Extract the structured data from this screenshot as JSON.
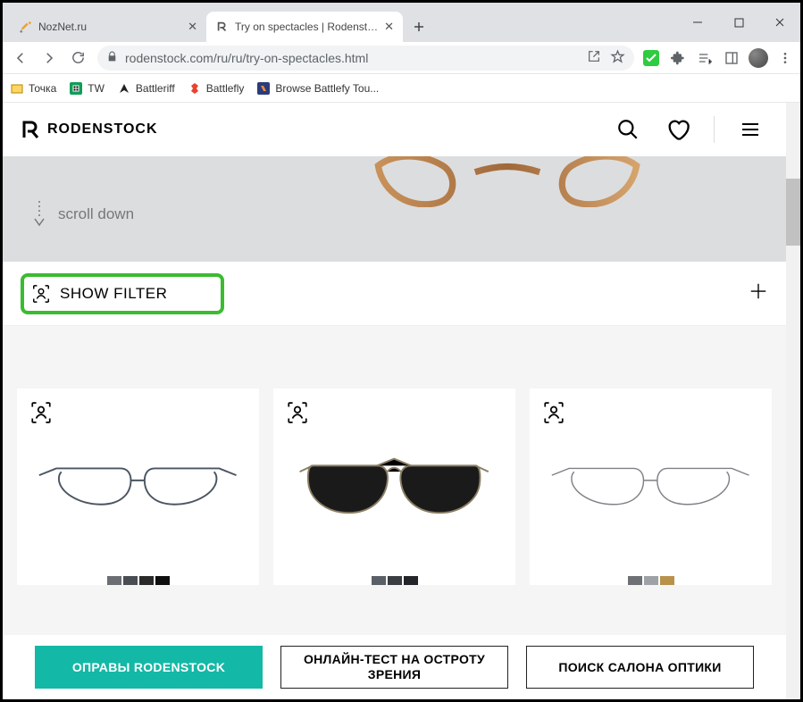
{
  "window": {
    "minimize": "—",
    "maximize": "▢",
    "close": "✕"
  },
  "tabs": [
    {
      "title": "NozNet.ru"
    },
    {
      "title": "Try on spectacles | Rodenstock"
    }
  ],
  "url": {
    "host": "rodenstock.com",
    "path": "/ru/ru/try-on-spectacles.html"
  },
  "bookmarks": [
    {
      "label": "Точка"
    },
    {
      "label": "TW"
    },
    {
      "label": "Battleriff"
    },
    {
      "label": "Battlefly"
    },
    {
      "label": "Browse Battlefy Tou..."
    }
  ],
  "brand": "RODENSTOCK",
  "banner": {
    "scroll": "scroll down"
  },
  "filter": {
    "label": "SHOW FILTER"
  },
  "cta": [
    "ОПРАВЫ RODENSTOCK",
    "ОНЛАЙН-ТЕСТ НА ОСТРОТУ ЗРЕНИЯ",
    "ПОИСК САЛОНА ОПТИКИ"
  ]
}
